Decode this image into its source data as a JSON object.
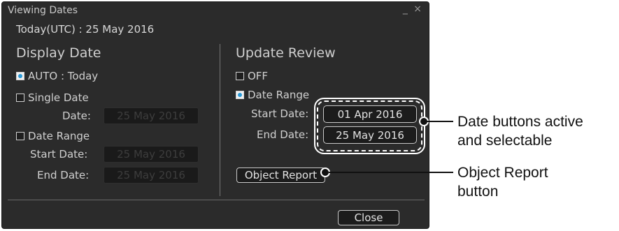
{
  "dialog": {
    "title": "Viewing Dates",
    "window_controls": "_ ×",
    "today": "Today(UTC) :  25 May 2016"
  },
  "display_date": {
    "heading": "Display Date",
    "auto_label": "AUTO : Today",
    "single_label": "Single Date",
    "date_label": "Date:",
    "date_value": "25 May 2016",
    "range_label": "Date Range",
    "start_label": "Start Date:",
    "start_value": "25 May 2016",
    "end_label": "End  Date:",
    "end_value": "25 May 2016"
  },
  "update_review": {
    "heading": "Update Review",
    "off_label": "OFF",
    "range_label": "Date Range",
    "start_label": "Start Date:",
    "start_value": "01 Apr 2016",
    "end_label": "End  Date:",
    "end_value": "25 May 2016",
    "object_report_label": "Object Report"
  },
  "footer": {
    "close_label": "Close"
  },
  "callouts": {
    "date_buttons_line1": "Date buttons active",
    "date_buttons_line2": "and selectable",
    "object_report_line1": "Object Report",
    "object_report_line2": "button"
  }
}
